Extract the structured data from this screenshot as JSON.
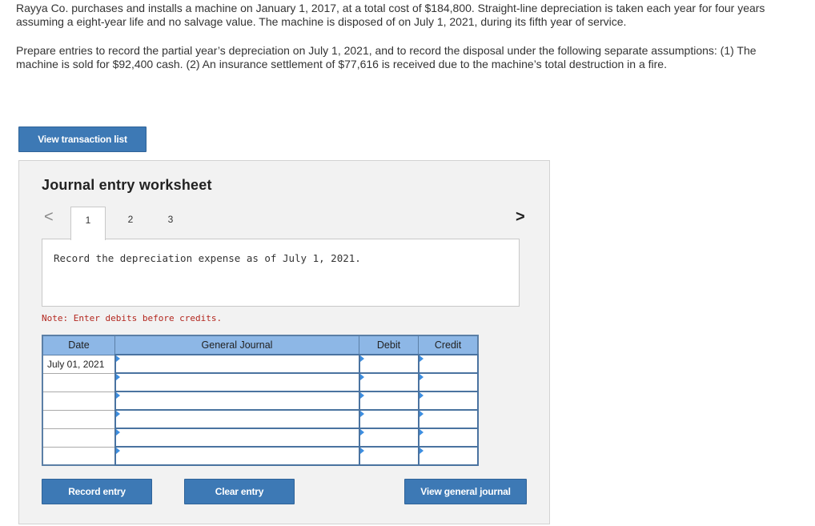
{
  "problem": {
    "paragraph1": "Rayya Co. purchases and installs a machine on January 1, 2017, at a total cost of $184,800. Straight-line depreciation is taken each year for four years assuming a eight-year life and no salvage value. The machine is disposed of on July 1, 2021, during its fifth year of service.",
    "paragraph2": "Prepare entries to record the partial year’s depreciation on July 1, 2021, and to record the disposal under the following separate assumptions: (1) The machine is sold for $92,400 cash. (2) An insurance settlement of $77,616 is received due to the machine’s total destruction in a fire."
  },
  "buttons": {
    "view_transaction_list": "View transaction list",
    "record_entry": "Record entry",
    "clear_entry": "Clear entry",
    "view_general_journal": "View general journal"
  },
  "worksheet": {
    "title": "Journal entry worksheet",
    "nav_prev": "<",
    "nav_next": ">",
    "tabs": [
      "1",
      "2",
      "3"
    ],
    "active_tab": "1",
    "instruction": "Record the depreciation expense as of July 1, 2021.",
    "note": "Note: Enter debits before credits."
  },
  "journal": {
    "headers": {
      "date": "Date",
      "general_journal": "General Journal",
      "debit": "Debit",
      "credit": "Credit"
    },
    "rows": [
      {
        "date": "July 01, 2021",
        "account": "",
        "debit": "",
        "credit": ""
      },
      {
        "date": "",
        "account": "",
        "debit": "",
        "credit": ""
      },
      {
        "date": "",
        "account": "",
        "debit": "",
        "credit": ""
      },
      {
        "date": "",
        "account": "",
        "debit": "",
        "credit": ""
      },
      {
        "date": "",
        "account": "",
        "debit": "",
        "credit": ""
      },
      {
        "date": "",
        "account": "",
        "debit": "",
        "credit": ""
      }
    ]
  },
  "colors": {
    "button_blue": "#3d79b5",
    "header_blue": "#8db7e6",
    "note_red": "#b3261e"
  }
}
